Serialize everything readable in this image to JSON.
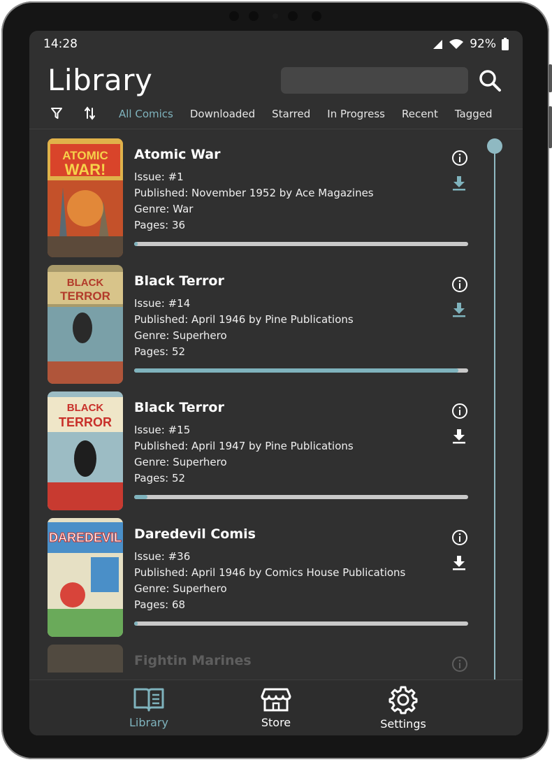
{
  "status": {
    "time": "14:28",
    "battery": "92%"
  },
  "header": {
    "title": "Library",
    "search_placeholder": ""
  },
  "tabs": [
    {
      "label": "All Comics",
      "active": true
    },
    {
      "label": "Downloaded",
      "active": false
    },
    {
      "label": "Starred",
      "active": false
    },
    {
      "label": "In Progress",
      "active": false
    },
    {
      "label": "Recent",
      "active": false
    },
    {
      "label": "Tagged",
      "active": false
    }
  ],
  "comics": [
    {
      "title": "Atomic War",
      "issue": "Issue: #1",
      "published": "Published: November 1952 by Ace Magazines",
      "genre": "Genre: War",
      "pages": "Pages: 36",
      "progress": 0.01,
      "downloaded": false
    },
    {
      "title": "Black Terror",
      "issue": "Issue: #14",
      "published": "Published: April 1946 by Pine Publications",
      "genre": "Genre: Superhero",
      "pages": "Pages: 52",
      "progress": 0.97,
      "downloaded": false
    },
    {
      "title": "Black Terror",
      "issue": "Issue: #15",
      "published": "Published: April 1947 by Pine Publications",
      "genre": "Genre: Superhero",
      "pages": "Pages: 52",
      "progress": 0.04,
      "downloaded": true
    },
    {
      "title": "Daredevil Comis",
      "issue": "Issue: #36",
      "published": "Published: April 1946 by Comics House Publications",
      "genre": "Genre: Superhero",
      "pages": "Pages: 68",
      "progress": 0.01,
      "downloaded": true
    },
    {
      "title": "Fightin Marines"
    }
  ],
  "nav": {
    "library": "Library",
    "store": "Store",
    "settings": "Settings"
  },
  "colors": {
    "accent": "#7fb3bd",
    "background": "#303030",
    "device": "#151515"
  }
}
